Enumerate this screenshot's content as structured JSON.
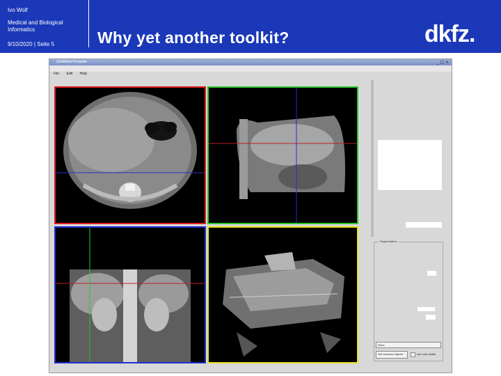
{
  "header": {
    "author": "Ivo Wolf",
    "department_line1": "Medical and Biological",
    "department_line2": "Informatics",
    "date_page": "9/10/2020 | Seite 5",
    "title": "Why yet another toolkit?",
    "logo": "dkfz."
  },
  "app_window": {
    "title": "QmitkMainTemplate",
    "controls": "_ □ ×",
    "menu": [
      "File",
      "Edit",
      "Help"
    ],
    "views": [
      {
        "name": "axial",
        "border_color": "#e01c1c"
      },
      {
        "name": "sagittal",
        "border_color": "#2cc72c"
      },
      {
        "name": "coronal",
        "border_color": "#1f2fd0"
      },
      {
        "name": "3d",
        "border_color": "#e3e31c"
      }
    ],
    "side_panel": {
      "group_label": "Segmentation",
      "field_value": "None",
      "button_label": "Get selected objects",
      "checkbox_label": "use only visible"
    }
  }
}
